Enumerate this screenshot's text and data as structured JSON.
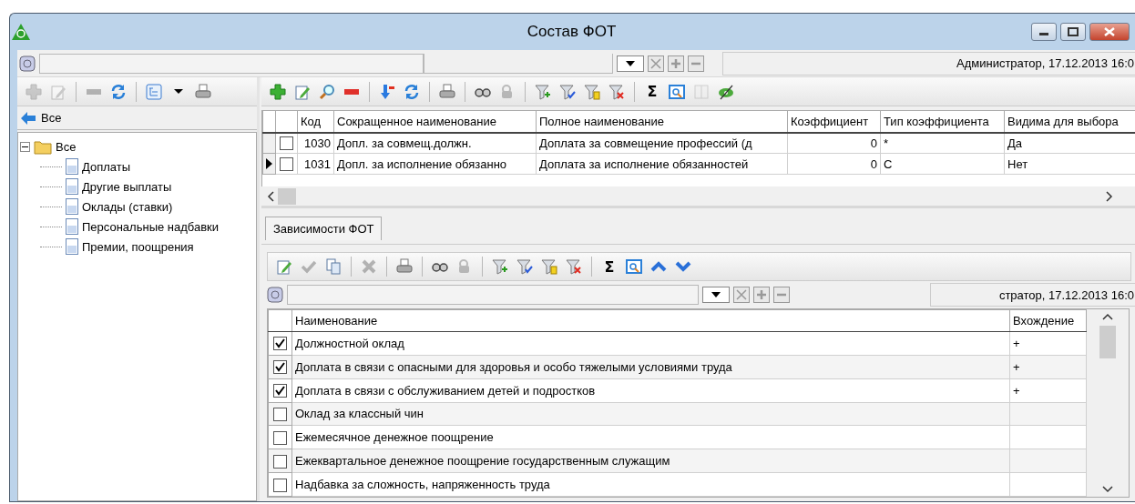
{
  "window": {
    "title": "Состав ФОТ"
  },
  "top_bar": {
    "status": "Администратор, 17.12.2013 16:0"
  },
  "left_panel": {
    "toolbar": [
      {
        "kind": "add",
        "disabled": true
      },
      {
        "kind": "edit",
        "disabled": true
      },
      {
        "kind": "separator"
      },
      {
        "kind": "remove",
        "disabled": true
      },
      {
        "kind": "refresh",
        "disabled": false
      },
      {
        "kind": "separator"
      },
      {
        "kind": "tree",
        "disabled": false
      },
      {
        "kind": "dropdown",
        "disabled": false
      },
      {
        "kind": "print",
        "disabled": false
      }
    ],
    "back": "Все",
    "tree": {
      "label": "Все",
      "expanded": true,
      "children": [
        {
          "label": "Доплаты"
        },
        {
          "label": "Другие выплаты"
        },
        {
          "label": "Оклады (ставки)"
        },
        {
          "label": "Персональные надбавки"
        },
        {
          "label": "Премии, поощрения"
        }
      ]
    }
  },
  "main_toolbar": [
    {
      "kind": "add",
      "disabled": false
    },
    {
      "kind": "edit",
      "disabled": false
    },
    {
      "kind": "find",
      "disabled": false
    },
    {
      "kind": "remove",
      "disabled": false
    },
    {
      "kind": "separator"
    },
    {
      "kind": "sort",
      "disabled": false
    },
    {
      "kind": "refresh",
      "disabled": false
    },
    {
      "kind": "separator"
    },
    {
      "kind": "print",
      "disabled": false
    },
    {
      "kind": "separator"
    },
    {
      "kind": "binoculars",
      "disabled": false
    },
    {
      "kind": "lock",
      "disabled": true
    },
    {
      "kind": "separator"
    },
    {
      "kind": "filter-add",
      "disabled": false
    },
    {
      "kind": "filter-check",
      "disabled": false
    },
    {
      "kind": "filter-list",
      "disabled": false
    },
    {
      "kind": "filter-clear",
      "disabled": false
    },
    {
      "kind": "separator"
    },
    {
      "kind": "sum",
      "label": "Σ",
      "disabled": false
    },
    {
      "kind": "preview",
      "disabled": false
    },
    {
      "kind": "columns",
      "disabled": true
    },
    {
      "kind": "eye-off",
      "disabled": false
    }
  ],
  "main_grid": {
    "columns": [
      "Код",
      "Сокращенное наименование",
      "Полное наименование",
      "Коэффициент",
      "Тип коэффициента",
      "Видима для выбора"
    ],
    "rows": [
      {
        "current": false,
        "checked": false,
        "cells": [
          "1030",
          "Допл. за совмещ.должн.",
          "Доплата за совмещение профессий (д",
          "0",
          "*",
          "Да"
        ]
      },
      {
        "current": true,
        "checked": false,
        "cells": [
          "1031",
          "Допл. за исполнение обязанно",
          "Доплата за исполнение обязанностей",
          "0",
          "С",
          "Нет"
        ]
      }
    ]
  },
  "tabs": [
    {
      "label": "Зависимости ФОТ",
      "selected": true
    }
  ],
  "sub_toolbar": [
    {
      "kind": "edit",
      "disabled": false
    },
    {
      "kind": "check",
      "disabled": true
    },
    {
      "kind": "copy",
      "disabled": false
    },
    {
      "kind": "separator"
    },
    {
      "kind": "delete",
      "disabled": true
    },
    {
      "kind": "separator"
    },
    {
      "kind": "print",
      "disabled": false
    },
    {
      "kind": "separator"
    },
    {
      "kind": "binoculars",
      "disabled": false
    },
    {
      "kind": "lock",
      "disabled": true
    },
    {
      "kind": "separator"
    },
    {
      "kind": "filter-add",
      "disabled": false
    },
    {
      "kind": "filter-check",
      "disabled": false
    },
    {
      "kind": "filter-list",
      "disabled": false
    },
    {
      "kind": "filter-clear",
      "disabled": false
    },
    {
      "kind": "separator"
    },
    {
      "kind": "sum",
      "label": "Σ",
      "disabled": false
    },
    {
      "kind": "preview",
      "disabled": false
    },
    {
      "kind": "up",
      "disabled": false
    },
    {
      "kind": "down",
      "disabled": false
    }
  ],
  "sub_filter": {
    "status": "стратор, 17.12.2013 16:0"
  },
  "sub_grid": {
    "columns": [
      "Наименование",
      "Вхождение"
    ],
    "rows": [
      {
        "checked": true,
        "cells": [
          "Должностной оклад",
          "+"
        ]
      },
      {
        "checked": true,
        "cells": [
          "Доплата в связи с опасными для здоровья и особо тяжелыми условиями труда",
          "+"
        ]
      },
      {
        "checked": true,
        "cells": [
          "Доплата в связи с обслуживанием детей и подростков",
          "+"
        ]
      },
      {
        "checked": false,
        "cells": [
          "Оклад за классный чин"
        ]
      },
      {
        "checked": false,
        "cells": [
          "Ежемесячное денежное поощрение"
        ]
      },
      {
        "checked": false,
        "cells": [
          "Ежеквартальное денежное поощрение государственным служащим"
        ]
      },
      {
        "checked": false,
        "cells": [
          "Надбавка за сложность, напряженность труда"
        ]
      }
    ]
  }
}
